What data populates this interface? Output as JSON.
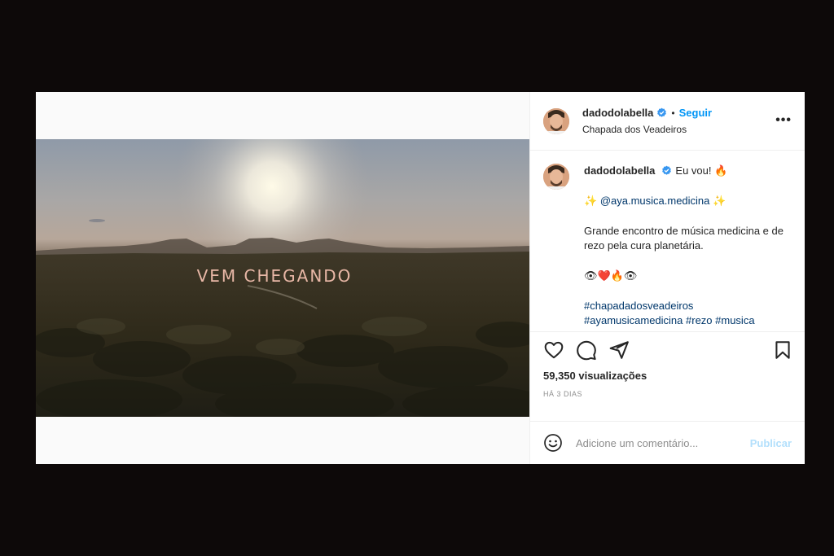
{
  "post": {
    "username": "dadodolabella",
    "dot": "•",
    "follow_label": "Seguir",
    "location": "Chapada dos Veadeiros",
    "more_label": "•••",
    "video_overlay_text": "VEM CHEGANDO"
  },
  "caption": {
    "username": "dadodolabella",
    "line1": "Eu vou! 🔥",
    "line2_prefix": "✨",
    "mention": "@aya.musica.medicina",
    "line2_suffix": "✨",
    "line3": "Grande encontro de música medicina e de rezo pela cura planetária.",
    "line4": "👁❤️🔥👁",
    "hashtags": "#chapadadosveadeiros #ayamusicamedicina #rezo #musica"
  },
  "stats": {
    "views": "59,350 visualizações",
    "time_ago": "HÁ 3 DIAS"
  },
  "comment_box": {
    "placeholder": "Adicione um comentário...",
    "publish_label": "Publicar"
  },
  "icons": {
    "like": "heart-icon",
    "comment": "comment-icon",
    "share": "send-icon",
    "save": "bookmark-icon",
    "emoji": "smiley-icon",
    "verified": "verified-badge-icon"
  },
  "colors": {
    "accent": "#0095f6",
    "publish_disabled": "#b2dffc",
    "background": "#0d0909"
  }
}
